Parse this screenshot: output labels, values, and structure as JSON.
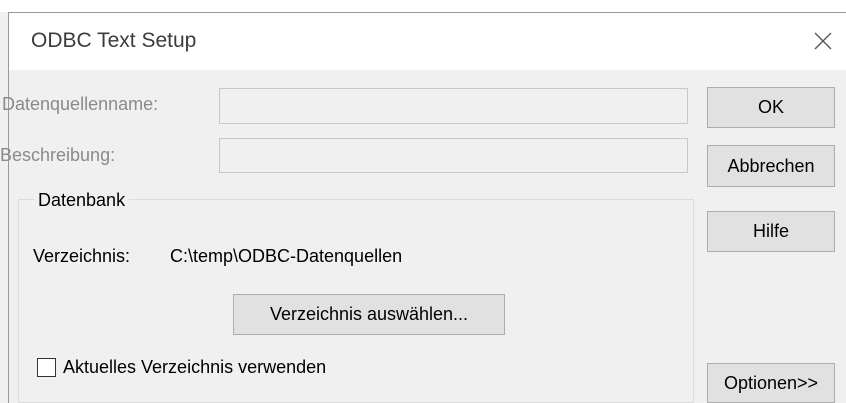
{
  "dialog": {
    "title": "ODBC Text Setup",
    "close_icon": "close-icon"
  },
  "fields": {
    "data_source_name_label": "Datenquellenname:",
    "data_source_name_value": "",
    "description_label": "Beschreibung:",
    "description_value": ""
  },
  "database_group": {
    "legend": "Datenbank",
    "directory_label": "Verzeichnis:",
    "directory_value": "C:\\temp\\ODBC-Datenquellen",
    "select_directory_button": "Verzeichnis auswählen...",
    "use_current_directory_label": "Aktuelles Verzeichnis verwenden",
    "use_current_directory_checked": false
  },
  "buttons": {
    "ok": "OK",
    "cancel": "Abbrechen",
    "help": "Hilfe",
    "options": "Optionen>>"
  },
  "colors": {
    "window_bg": "#f0f0f0",
    "titlebar_bg": "#ffffff",
    "disabled_text": "#8a8a8a",
    "button_face": "#e1e1e1"
  }
}
